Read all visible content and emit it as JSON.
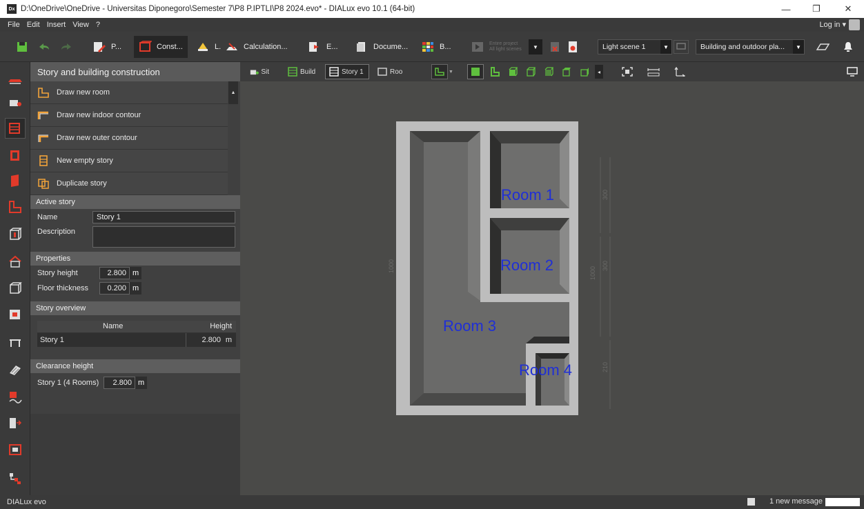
{
  "window": {
    "title": "D:\\OneDrive\\OneDrive - Universitas Diponegoro\\Semester 7\\P8 P.IPTLI\\P8 2024.evo* - DIALux evo 10.1  (64-bit)",
    "app_icon_text": "Dx",
    "minimize": "—",
    "restore": "❐",
    "close": "✕"
  },
  "menu": {
    "items": [
      "File",
      "Edit",
      "Insert",
      "View",
      "?"
    ],
    "login": "Log in ▾"
  },
  "toolbar": {
    "mode_project": "P...",
    "mode_construction": "Const...",
    "mode_light": "L.",
    "mode_calculation": "Calculation...",
    "mode_export": "E...",
    "mode_documentation": "Docume...",
    "mode_bim": "B...",
    "scene_scope_line1": "Entire project",
    "scene_scope_line2": "All light scenes",
    "light_scene": "Light scene 1",
    "view_mode": "Building and outdoor pla..."
  },
  "panel": {
    "title": "Story and building construction",
    "tools": [
      "Draw new room",
      "Draw new indoor contour",
      "Draw new outer contour",
      "New empty story",
      "Duplicate story"
    ],
    "active_story": {
      "header": "Active story",
      "name_label": "Name",
      "name_value": "Story 1",
      "description_label": "Description",
      "description_value": ""
    },
    "properties": {
      "header": "Properties",
      "story_height_label": "Story height",
      "story_height_value": "2.800",
      "floor_thickness_label": "Floor thickness",
      "floor_thickness_value": "0.200",
      "unit": "m"
    },
    "story_overview": {
      "header": "Story overview",
      "col_name": "Name",
      "col_height": "Height",
      "rows": [
        {
          "name": "Story 1",
          "height": "2.800",
          "unit": "m"
        }
      ]
    },
    "clearance": {
      "header": "Clearance height",
      "label": "Story 1 (4 Rooms)",
      "value": "2.800",
      "unit": "m"
    }
  },
  "viewport_tabs": {
    "site": "Sit",
    "building": "Build",
    "story": "Story 1",
    "room": "Roo"
  },
  "plan": {
    "rooms": [
      "Room 1",
      "Room 2",
      "Room 3",
      "Room 4"
    ],
    "dimensions": {
      "left": "1000",
      "right_upper": "300",
      "right_mid_inner": "1000",
      "right_mid_outer": "300",
      "right_lower": "210"
    },
    "room_label_color": "#1f2fd6"
  },
  "status": {
    "brand": "DIALux evo",
    "message": "1 new message"
  }
}
